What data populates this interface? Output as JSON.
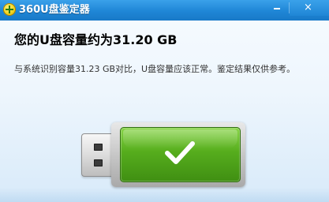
{
  "window": {
    "title": "360U盘鉴定器",
    "minimize_label": "—",
    "close_label": "×"
  },
  "result": {
    "headline": "您的U盘容量约为31.20 GB",
    "detail": "与系统识别容量31.23 GB对比，U盘容量应该正常。鉴定结果仅供参考。"
  },
  "colors": {
    "titlebar": "#1f86d6",
    "usb_green": "#56ad1d",
    "check": "#ffffff"
  },
  "icons": {
    "app": "360-logo-icon",
    "status": "checkmark-icon",
    "device": "usb-drive-icon"
  }
}
